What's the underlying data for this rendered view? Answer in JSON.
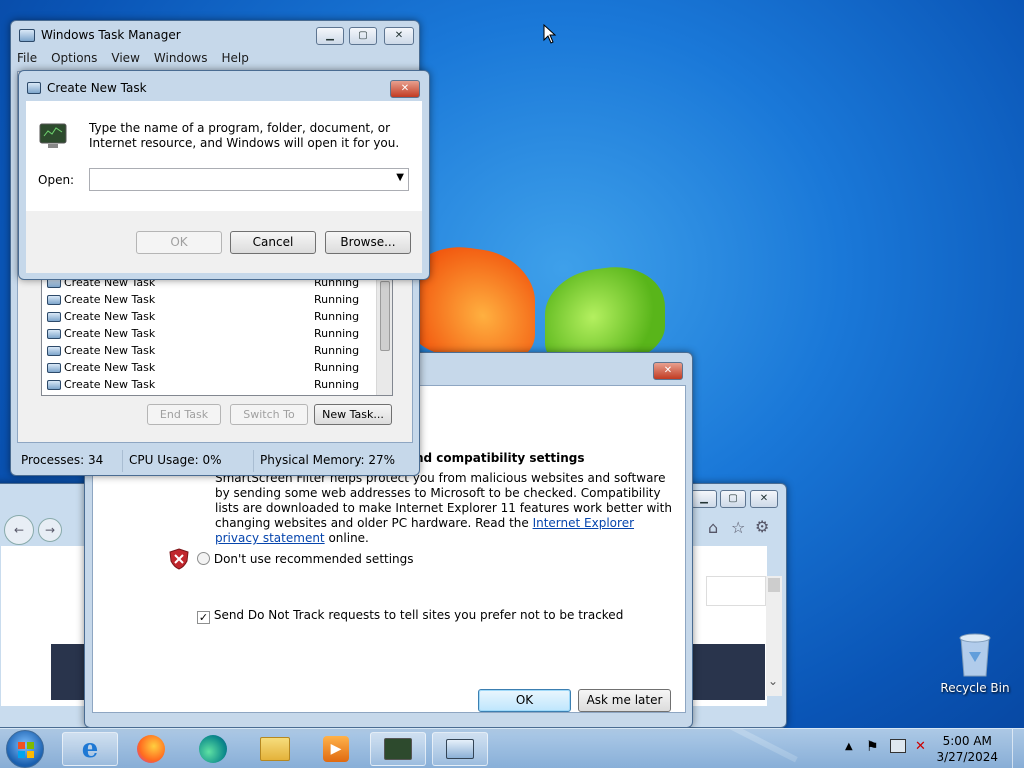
{
  "desktop": {
    "recycle_bin_label": "Recycle Bin"
  },
  "task_manager": {
    "title": "Windows Task Manager",
    "menu": [
      "File",
      "Options",
      "View",
      "Windows",
      "Help"
    ],
    "rows": [
      {
        "name": "Create New Task",
        "status": "Running"
      },
      {
        "name": "Create New Task",
        "status": "Running"
      },
      {
        "name": "Create New Task",
        "status": "Running"
      },
      {
        "name": "Create New Task",
        "status": "Running"
      },
      {
        "name": "Create New Task",
        "status": "Running"
      },
      {
        "name": "Create New Task",
        "status": "Running"
      },
      {
        "name": "Create New Task",
        "status": "Running"
      }
    ],
    "end_task": "End Task",
    "switch_to": "Switch To",
    "new_task": "New Task...",
    "status_processes": "Processes: 34",
    "status_cpu": "CPU Usage: 0%",
    "status_memory": "Physical Memory: 27%"
  },
  "create_task": {
    "title": "Create New Task",
    "description": "Type the name of a program, folder, document, or Internet resource, and Windows will open it for you.",
    "open_label": "Open:",
    "open_value": "",
    "ok": "OK",
    "cancel": "Cancel",
    "browse": "Browse..."
  },
  "ie_dialog": {
    "heading_partial": "nd compatibility settings",
    "body_before_link": "SmartScreen Filter helps protect you from malicious websites and software by sending some web addresses to Microsoft to be checked. Compatibility lists are downloaded to make Internet Explorer 11 features work better with changing websites and older PC hardware. Read the ",
    "link_text": "Internet Explorer privacy statement",
    "body_after_link": " online.",
    "option_dont_use": "Don't use recommended settings",
    "option_dnt": "Send Do Not Track requests to tell sites you prefer not to be tracked",
    "ok": "OK",
    "ask_later": "Ask me later"
  },
  "taskbar": {
    "time": "5:00 AM",
    "date": "3/27/2024",
    "icons": [
      "start-orb-icon",
      "internet-explorer-icon",
      "firefox-icon",
      "edge-icon",
      "file-explorer-icon",
      "media-player-icon",
      "task-manager-icon",
      "run-dialog-icon"
    ]
  }
}
